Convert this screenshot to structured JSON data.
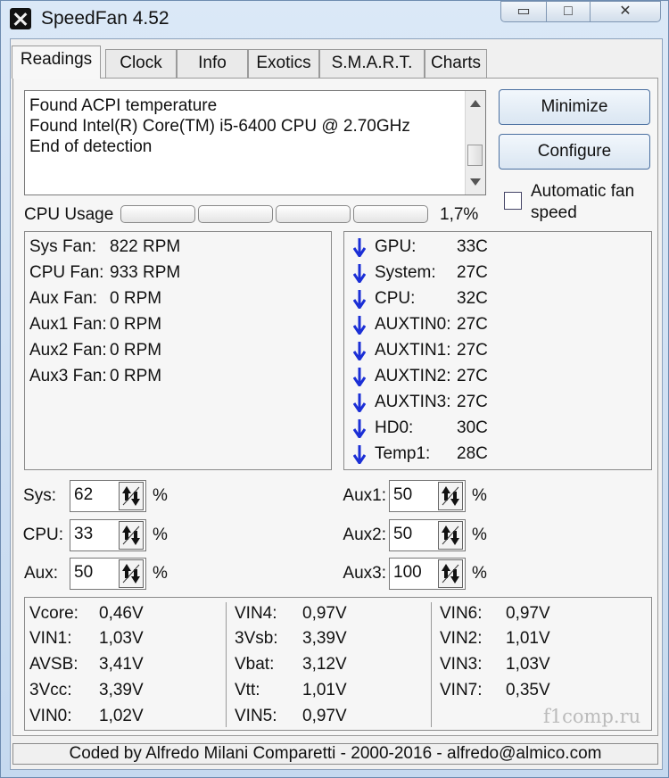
{
  "window": {
    "title": "SpeedFan 4.52",
    "controls": {
      "minimize": "▭",
      "maximize": "□",
      "close": "✕"
    }
  },
  "tabs": [
    "Readings",
    "Clock",
    "Info",
    "Exotics",
    "S.M.A.R.T.",
    "Charts"
  ],
  "active_tab": "Readings",
  "log": [
    "Found ACPI temperature",
    "Found Intel(R) Core(TM) i5-6400 CPU @ 2.70GHz",
    "End of detection"
  ],
  "buttons": {
    "minimize": "Minimize",
    "configure": "Configure"
  },
  "auto_fan": {
    "label": "Automatic fan speed",
    "checked": false
  },
  "cpu_usage": {
    "label": "CPU Usage",
    "value": "1,7%",
    "bar_count": 4
  },
  "fans": [
    {
      "label": "Sys Fan:",
      "value": "822 RPM"
    },
    {
      "label": "CPU Fan:",
      "value": "933 RPM"
    },
    {
      "label": "Aux Fan:",
      "value": "0 RPM"
    },
    {
      "label": "Aux1 Fan:",
      "value": "0 RPM"
    },
    {
      "label": "Aux2 Fan:",
      "value": "0 RPM"
    },
    {
      "label": "Aux3 Fan:",
      "value": "0 RPM"
    }
  ],
  "temps": [
    {
      "label": "GPU:",
      "value": "33C"
    },
    {
      "label": "System:",
      "value": "27C"
    },
    {
      "label": "CPU:",
      "value": "32C"
    },
    {
      "label": "AUXTIN0:",
      "value": "27C"
    },
    {
      "label": "AUXTIN1:",
      "value": "27C"
    },
    {
      "label": "AUXTIN2:",
      "value": "27C"
    },
    {
      "label": "AUXTIN3:",
      "value": "27C"
    },
    {
      "label": "HD0:",
      "value": "30C"
    },
    {
      "label": "Temp1:",
      "value": "28C"
    }
  ],
  "speeds": [
    {
      "label": "Sys:",
      "value": "62",
      "unit": "%"
    },
    {
      "label": "CPU:",
      "value": "33",
      "unit": "%"
    },
    {
      "label": "Aux:",
      "value": "50",
      "unit": "%"
    },
    {
      "label": "Aux1:",
      "value": "50",
      "unit": "%"
    },
    {
      "label": "Aux2:",
      "value": "50",
      "unit": "%"
    },
    {
      "label": "Aux3:",
      "value": "100",
      "unit": "%"
    }
  ],
  "voltages": [
    [
      {
        "label": "Vcore:",
        "value": "0,46V"
      },
      {
        "label": "VIN1:",
        "value": "1,03V"
      },
      {
        "label": "AVSB:",
        "value": "3,41V"
      },
      {
        "label": "3Vcc:",
        "value": "3,39V"
      },
      {
        "label": "VIN0:",
        "value": "1,02V"
      }
    ],
    [
      {
        "label": "VIN4:",
        "value": "0,97V"
      },
      {
        "label": "3Vsb:",
        "value": "3,39V"
      },
      {
        "label": "Vbat:",
        "value": "3,12V"
      },
      {
        "label": "Vtt:",
        "value": "1,01V"
      },
      {
        "label": "VIN5:",
        "value": "0,97V"
      }
    ],
    [
      {
        "label": "VIN6:",
        "value": "0,97V"
      },
      {
        "label": "VIN2:",
        "value": "1,01V"
      },
      {
        "label": "VIN3:",
        "value": "1,03V"
      },
      {
        "label": "VIN7:",
        "value": "0,35V"
      }
    ]
  ],
  "watermark": "f1comp.ru",
  "footer": "Coded by Alfredo Milani Comparetti - 2000-2016 - alfredo@almico.com",
  "colors": {
    "arrow": "#1b2fd6",
    "accent_border": "#4a6fa0"
  }
}
